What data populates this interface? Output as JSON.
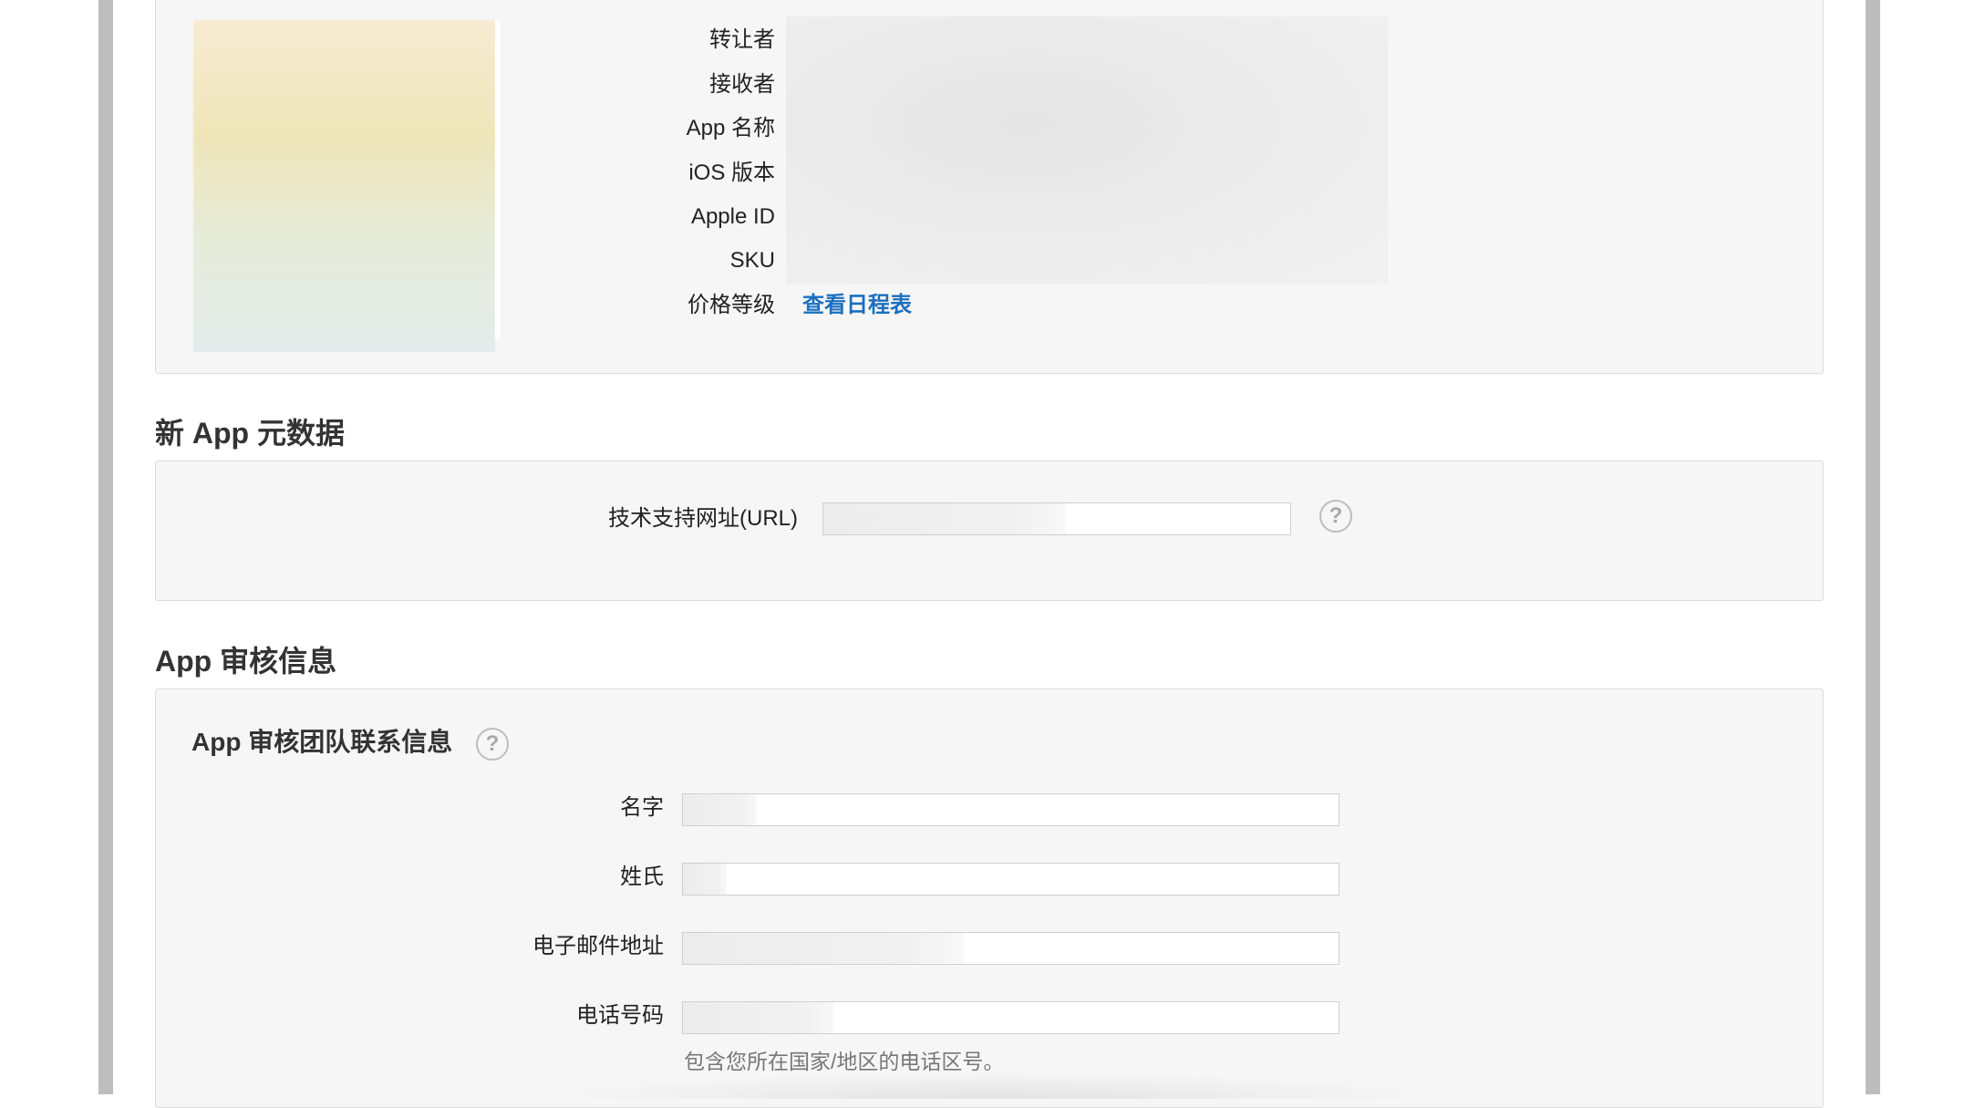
{
  "app_info": {
    "labels": [
      "转让者",
      "接收者",
      "App 名称",
      "iOS 版本",
      "Apple ID",
      "SKU",
      "价格等级"
    ],
    "price_link": "查看日程表"
  },
  "metadata_section": {
    "title": "新 App 元数据",
    "support_url_label": "技术支持网址(URL)",
    "help_icon": "question-mark"
  },
  "review_section": {
    "title": "App 审核信息",
    "contact_title": "App 审核团队联系信息",
    "help_icon": "question-mark",
    "fields": {
      "first_name_label": "名字",
      "last_name_label": "姓氏",
      "email_label": "电子邮件地址",
      "phone_label": "电话号码"
    },
    "phone_hint": "包含您所在国家/地区的电话区号。"
  },
  "colors": {
    "link": "#1a6fbf",
    "panel_bg": "#f6f6f6",
    "panel_border": "#dcdcdc"
  }
}
